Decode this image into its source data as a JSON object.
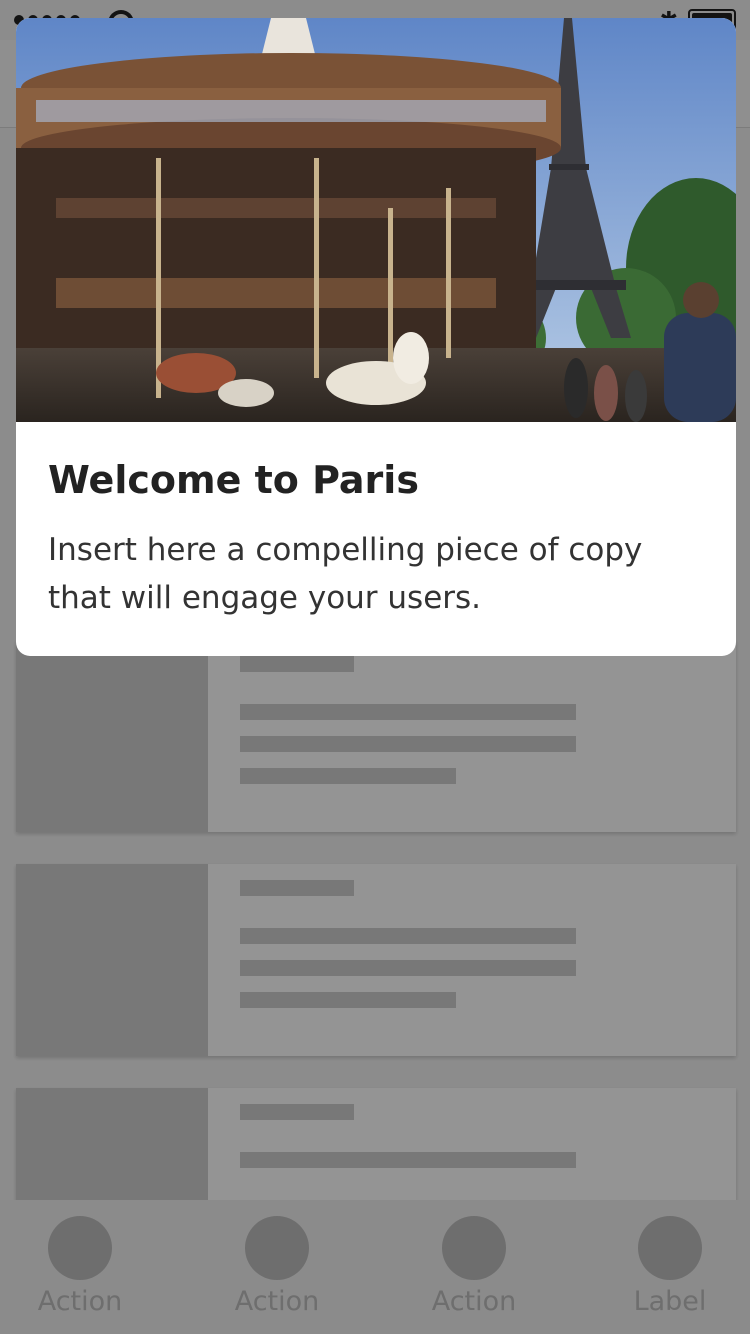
{
  "modal": {
    "title": "Welcome to Paris",
    "body": "Insert here a compelling piece of copy that will engage your users."
  },
  "cards": [
    {
      "skeleton": true
    },
    {
      "skeleton": true
    },
    {
      "skeleton": true
    }
  ],
  "tab_bar": {
    "tabs": [
      {
        "label": "Action"
      },
      {
        "label": "Action"
      },
      {
        "label": "Action"
      },
      {
        "label": "Label"
      }
    ]
  },
  "colors": {
    "scrim": "#000000",
    "skeleton": "#cfcfcf",
    "title": "#222222"
  },
  "icons": [
    "wifi-icon",
    "bluetooth-icon",
    "battery-icon"
  ]
}
